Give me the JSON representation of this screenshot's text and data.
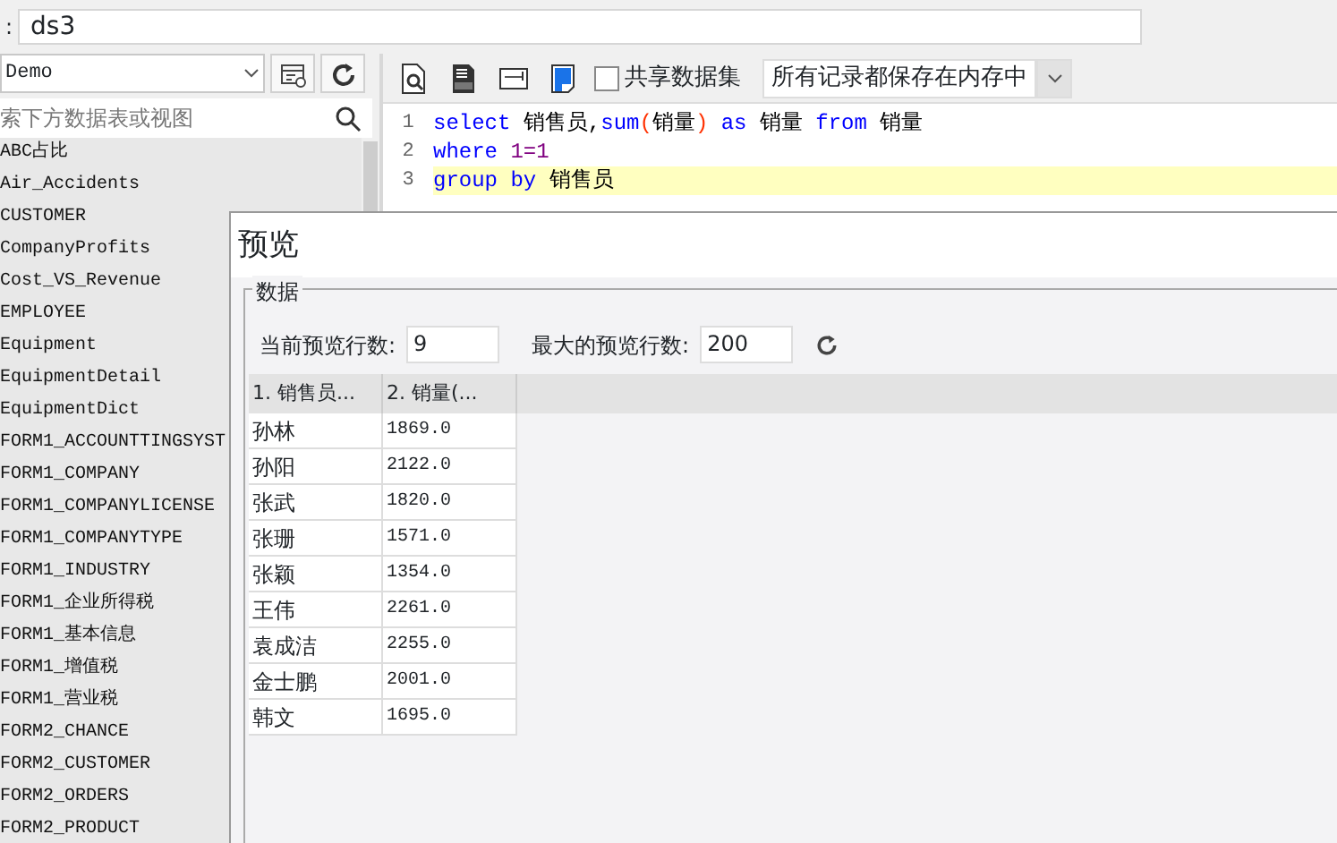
{
  "name_field": {
    "label": ":",
    "value": "ds3"
  },
  "sidebar": {
    "datasource": "Demo",
    "search": {
      "placeholder": "索下方数据表或视图"
    },
    "items": [
      "ABC占比",
      "Air_Accidents",
      "CUSTOMER",
      "CompanyProfits",
      "Cost_VS_Revenue",
      "EMPLOYEE",
      "Equipment",
      "EquipmentDetail",
      "EquipmentDict",
      "FORM1_ACCOUNTTINGSYST",
      "FORM1_COMPANY",
      "FORM1_COMPANYLICENSE",
      "FORM1_COMPANYTYPE",
      "FORM1_INDUSTRY",
      "FORM1_企业所得税",
      "FORM1_基本信息",
      "FORM1_增值税",
      "FORM1_营业税",
      "FORM2_CHANCE",
      "FORM2_CUSTOMER",
      "FORM2_ORDERS",
      "FORM2_PRODUCT"
    ]
  },
  "toolbar": {
    "share_checkbox": {
      "label": "共享数据集",
      "checked": false
    },
    "storage_select": "所有记录都保存在内存中"
  },
  "editor": {
    "lines": [
      {
        "number": "1",
        "current": false,
        "tokens": [
          {
            "text": "select",
            "kind": "keyword"
          },
          {
            "text": " 销售员,",
            "kind": "plain"
          },
          {
            "text": "sum",
            "kind": "keyword"
          },
          {
            "text": "(",
            "kind": "paren"
          },
          {
            "text": "销量",
            "kind": "plain"
          },
          {
            "text": ")",
            "kind": "paren"
          },
          {
            "text": " as",
            "kind": "keyword"
          },
          {
            "text": " 销量 ",
            "kind": "plain"
          },
          {
            "text": "from",
            "kind": "keyword"
          },
          {
            "text": " 销量",
            "kind": "plain"
          }
        ]
      },
      {
        "number": "2",
        "current": false,
        "tokens": [
          {
            "text": "where",
            "kind": "keyword"
          },
          {
            "text": " 1=1",
            "kind": "number"
          }
        ]
      },
      {
        "number": "3",
        "current": true,
        "tokens": [
          {
            "text": "group by",
            "kind": "keyword"
          },
          {
            "text": " 销售员",
            "kind": "plain"
          }
        ]
      }
    ]
  },
  "preview": {
    "title": "预览",
    "group_title": "数据",
    "current_rows": {
      "label": "当前预览行数:",
      "value": "9"
    },
    "max_rows": {
      "label": "最大的预览行数:",
      "value": "200"
    },
    "table": {
      "columns": [
        "1. 销售员...",
        "2. 销量(..."
      ],
      "rows": [
        [
          "孙林",
          "1869.0"
        ],
        [
          "孙阳",
          "2122.0"
        ],
        [
          "张武",
          "1820.0"
        ],
        [
          "张珊",
          "1571.0"
        ],
        [
          "张颖",
          "1354.0"
        ],
        [
          "王伟",
          "2261.0"
        ],
        [
          "袁成洁",
          "2255.0"
        ],
        [
          "金士鹏",
          "2001.0"
        ],
        [
          "韩文",
          "1695.0"
        ]
      ]
    }
  }
}
